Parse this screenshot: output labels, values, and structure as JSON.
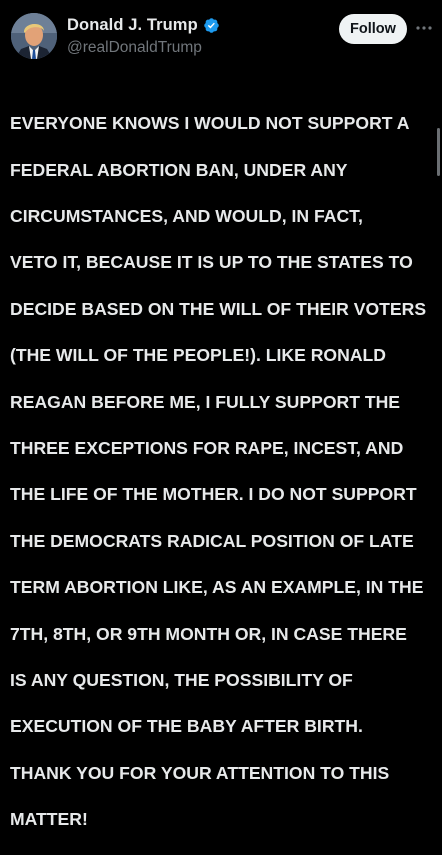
{
  "author": {
    "display_name": "Donald J. Trump",
    "handle": "@realDonaldTrump",
    "verified": true
  },
  "actions": {
    "follow_label": "Follow",
    "more_icon": "more-horizontal-icon"
  },
  "post": {
    "text_lines": [
      "EVERYONE KNOWS I WOULD NOT SUPPORT A",
      "FEDERAL ABORTION BAN, UNDER ANY",
      "CIRCUMSTANCES, AND WOULD, IN FACT,",
      "VETO IT, BECAUSE IT IS UP TO THE STATES TO",
      "DECIDE BASED ON THE WILL OF THEIR VOTERS",
      "(THE WILL OF THE PEOPLE!). LIKE RONALD",
      "REAGAN BEFORE ME, I FULLY SUPPORT THE",
      "THREE EXCEPTIONS FOR RAPE, INCEST, AND",
      "THE LIFE OF THE MOTHER. I DO NOT SUPPORT",
      "THE DEMOCRATS RADICAL POSITION OF LATE",
      "TERM ABORTION LIKE, AS AN EXAMPLE, IN THE",
      "7TH, 8TH, OR 9TH MONTH OR, IN CASE THERE",
      "IS ANY QUESTION, THE POSSIBILITY OF",
      "EXECUTION OF THE BABY AFTER BIRTH.",
      "THANK YOU FOR YOUR ATTENTION TO THIS",
      "MATTER!"
    ]
  },
  "colors": {
    "background": "#000000",
    "text_primary": "#e7e9ea",
    "text_secondary": "#71767b",
    "verified_badge": "#1d9bf0",
    "follow_button_bg": "#eff3f4",
    "follow_button_text": "#0f1419"
  }
}
